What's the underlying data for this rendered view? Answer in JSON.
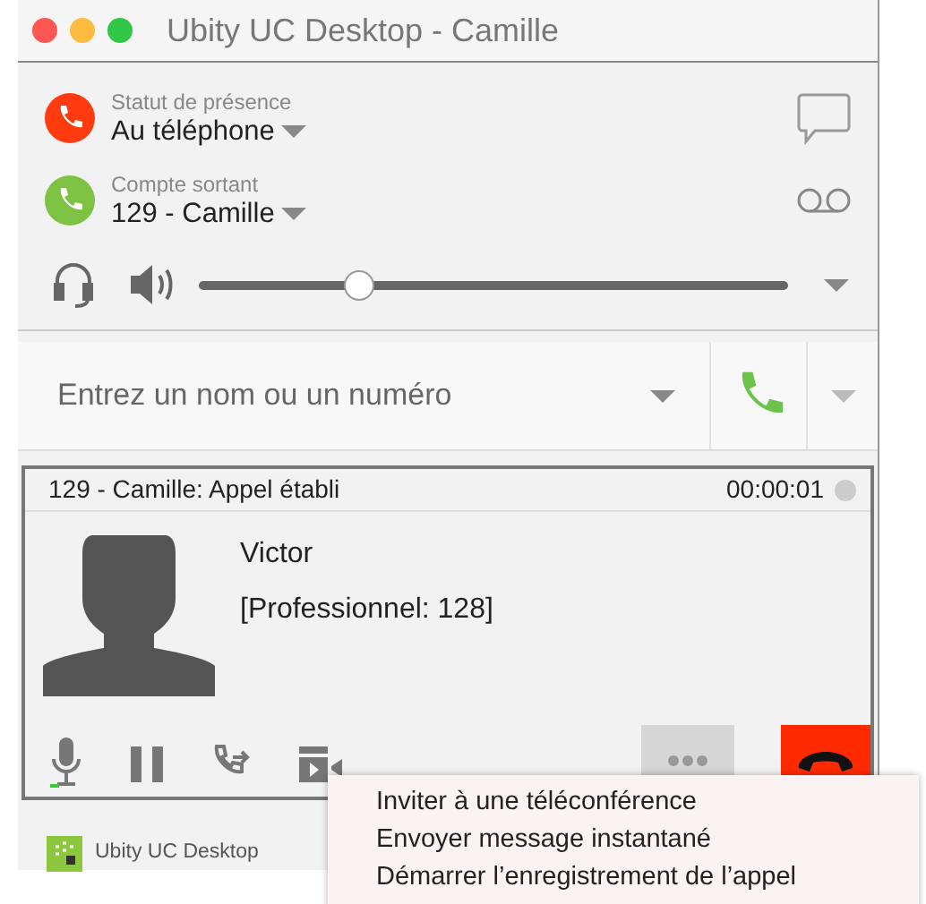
{
  "window": {
    "title": "Ubity UC Desktop - Camille"
  },
  "presence": {
    "label": "Statut de présence",
    "value": "Au téléphone"
  },
  "account": {
    "label": "Compte sortant",
    "value": "129 - Camille"
  },
  "volume": {
    "level": 0.27
  },
  "dial": {
    "placeholder": "Entrez un nom ou un numéro"
  },
  "call": {
    "status": "129 - Camille: Appel établi",
    "timer": "00:00:01",
    "contact_name": "Victor",
    "contact_detail": "[Professionnel: 128]"
  },
  "footer": {
    "app_name": "Ubity UC Desktop"
  },
  "menu": {
    "items": [
      {
        "label": "Inviter à une téléconférence"
      },
      {
        "label": "Envoyer message instantané"
      },
      {
        "label": "Démarrer l’enregistrement de l’appel"
      }
    ]
  }
}
